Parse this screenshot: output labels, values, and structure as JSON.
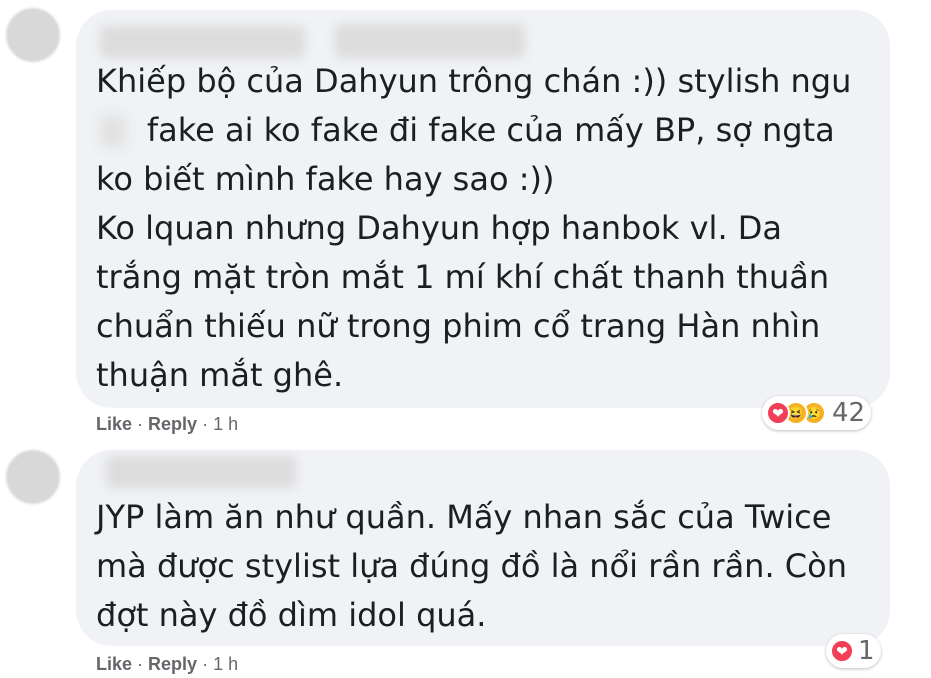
{
  "comments": [
    {
      "text": "Khiếp bộ của Dahyun trông chán :)) stylish ngu\n     fake ai ko fake đi fake của mấy BP, sợ ngta\nko biết mình fake hay sao :))\nKo lquan nhưng Dahyun hợp hanbok vl. Da\ntrắng mặt tròn mắt 1 mí khí chất thanh thuần\nchuẩn thiếu nữ trong phim cổ trang Hàn nhìn\nthuận mắt ghê.",
      "like": "Like",
      "sep1": " · ",
      "reply": "Reply",
      "sep2": " · ",
      "time": "1 h",
      "reaction_count": "42",
      "reactions": [
        "love-icon",
        "haha-icon",
        "sad-icon"
      ]
    },
    {
      "text": "JYP làm ăn như quần. Mấy nhan sắc của Twice\nmà được stylist lựa đúng đồ là nổi rần rần. Còn\nđợt này đồ dìm idol quá.",
      "like": "Like",
      "sep1": " · ",
      "reply": "Reply",
      "sep2": " · ",
      "time": "1 h",
      "reaction_count": "1",
      "reactions": [
        "love-icon"
      ]
    }
  ],
  "colors": {
    "bubble": "#f0f2f5",
    "text": "#1c1e21",
    "meta": "#65676b",
    "love": "#f33e58",
    "haha": "#f7b125"
  }
}
